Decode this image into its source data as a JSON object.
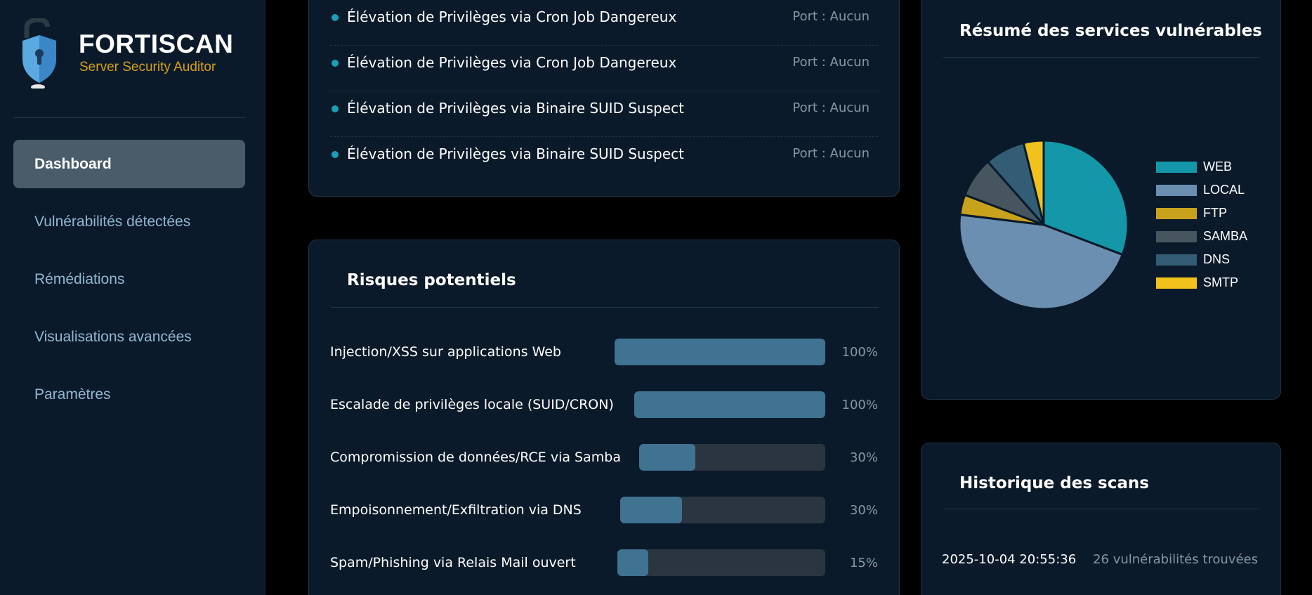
{
  "sidebar": {
    "brand": {
      "name": "FORTISCAN",
      "subtitle": "Server Security Auditor"
    },
    "items": [
      {
        "label": "Dashboard",
        "active": true
      },
      {
        "label": "Vulnérabilités détectées",
        "active": false
      },
      {
        "label": "Rémédiations",
        "active": false
      },
      {
        "label": "Visualisations avancées",
        "active": false
      },
      {
        "label": "Paramètres",
        "active": false
      }
    ]
  },
  "vulnerabilities": [
    {
      "title": "Élévation de Privilèges via Cron Job Dangereux",
      "port": "Port : Aucun"
    },
    {
      "title": "Élévation de Privilèges via Cron Job Dangereux",
      "port": "Port : Aucun"
    },
    {
      "title": "Élévation de Privilèges via Binaire SUID Suspect",
      "port": "Port : Aucun"
    },
    {
      "title": "Élévation de Privilèges via Binaire SUID Suspect",
      "port": "Port : Aucun"
    }
  ],
  "risks": {
    "title": "Risques potentiels",
    "items": [
      {
        "label": "Injection/XSS sur applications Web",
        "value": 100,
        "pct": "100%"
      },
      {
        "label": "Escalade de privilèges locale (SUID/CRON)",
        "value": 100,
        "pct": "100%"
      },
      {
        "label": "Compromission de données/RCE via Samba",
        "value": 30,
        "pct": "30%"
      },
      {
        "label": "Empoisonnement/Exfiltration via DNS",
        "value": 30,
        "pct": "30%"
      },
      {
        "label": "Spam/Phishing via Relais Mail ouvert",
        "value": 15,
        "pct": "15%"
      }
    ]
  },
  "services": {
    "title": "Résumé des services vulnérables",
    "legend": [
      {
        "label": "WEB",
        "color": "#1497a8"
      },
      {
        "label": "LOCAL",
        "color": "#6b8fb0"
      },
      {
        "label": "FTP",
        "color": "#c9a21d"
      },
      {
        "label": "SAMBA",
        "color": "#47555f"
      },
      {
        "label": "DNS",
        "color": "#325d74"
      },
      {
        "label": "SMTP",
        "color": "#f2c21c"
      }
    ]
  },
  "chart_data": {
    "type": "pie",
    "title": "Résumé des services vulnérables",
    "categories": [
      "WEB",
      "LOCAL",
      "FTP",
      "SAMBA",
      "DNS",
      "SMTP"
    ],
    "values": [
      8,
      12,
      1,
      2,
      2,
      1
    ],
    "colors": [
      "#1497a8",
      "#6b8fb0",
      "#c9a21d",
      "#47555f",
      "#325d74",
      "#f2c21c"
    ],
    "legend": "right"
  },
  "history": {
    "title": "Historique des scans",
    "rows": [
      {
        "date": "2025-10-04 20:55:36",
        "count": "26 vulnérabilités trouvées"
      }
    ]
  }
}
